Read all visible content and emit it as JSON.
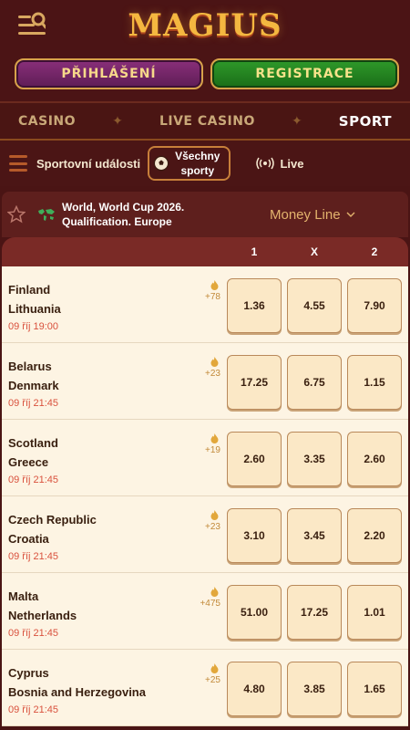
{
  "header": {
    "logo": "MAGIUS",
    "login_label": "PŘIHLÁŠENÍ",
    "register_label": "REGISTRACE"
  },
  "nav": {
    "items": [
      {
        "label": "CASINO"
      },
      {
        "label": "LIVE CASINO"
      },
      {
        "label": "SPORT"
      }
    ],
    "active": "SPORT"
  },
  "subnav": {
    "events_label": "Sportovní události",
    "all_sports_line1": "Všechny",
    "all_sports_line2": "sporty",
    "live_label": "Live"
  },
  "event": {
    "title_line1": "World, World Cup 2026.",
    "title_line2": "Qualification. Europe",
    "market": "Money Line"
  },
  "columns": [
    "1",
    "X",
    "2"
  ],
  "matches": [
    {
      "home": "Finland",
      "away": "Lithuania",
      "time": "09 říj 19:00",
      "more": "+78",
      "odds": [
        "1.36",
        "4.55",
        "7.90"
      ]
    },
    {
      "home": "Belarus",
      "away": "Denmark",
      "time": "09 říj 21:45",
      "more": "+23",
      "odds": [
        "17.25",
        "6.75",
        "1.15"
      ]
    },
    {
      "home": "Scotland",
      "away": "Greece",
      "time": "09 říj 21:45",
      "more": "+19",
      "odds": [
        "2.60",
        "3.35",
        "2.60"
      ]
    },
    {
      "home": "Czech Republic",
      "away": "Croatia",
      "time": "09 říj 21:45",
      "more": "+23",
      "odds": [
        "3.10",
        "3.45",
        "2.20"
      ]
    },
    {
      "home": "Malta",
      "away": "Netherlands",
      "time": "09 říj 21:45",
      "more": "+475",
      "odds": [
        "51.00",
        "17.25",
        "1.01"
      ]
    },
    {
      "home": "Cyprus",
      "away": "Bosnia and Herzegovina",
      "time": "09 říj 21:45",
      "more": "+25",
      "odds": [
        "4.80",
        "3.85",
        "1.65"
      ]
    }
  ],
  "colors": {
    "bg": "#4a1414",
    "gold": "#f4b740",
    "odd_bg": "#fbe8c6",
    "time_red": "#d9513d"
  },
  "icons": [
    "menu-search-icon",
    "hamburger-icon",
    "soccer-ball-icon",
    "live-signal-icon",
    "star-icon",
    "globe-icon",
    "chevron-down-icon",
    "flame-icon"
  ]
}
